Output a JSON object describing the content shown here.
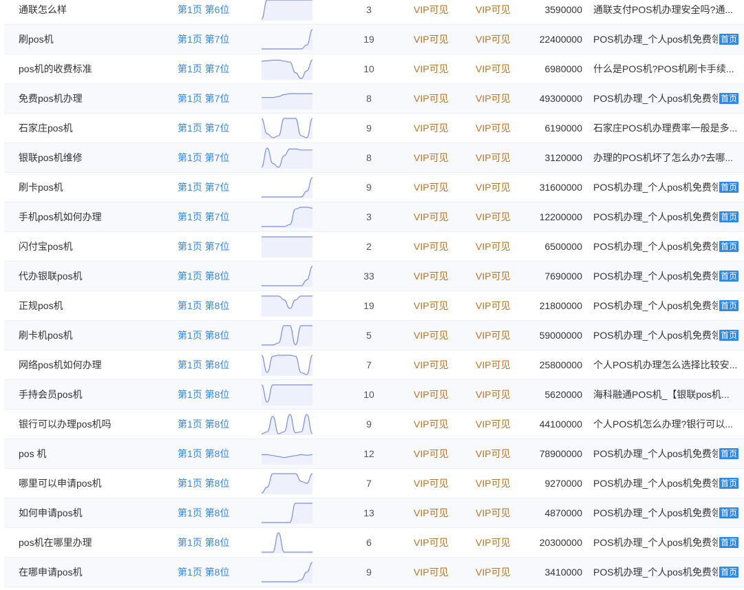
{
  "rows": [
    {
      "keyword": "通联怎么样",
      "rank": "第1页 第6位",
      "count": "3",
      "vip_a": "VIP可见",
      "vip_b": "VIP可见",
      "volume": "3590000",
      "title": "通联支付POS机办理安全吗?通...",
      "badge": "",
      "trend": [
        0.0,
        1.0,
        1.0,
        1.0,
        1.0,
        1.0,
        1.0,
        1.0,
        1.0,
        1.0
      ]
    },
    {
      "keyword": "刷pos机",
      "rank": "第1页 第7位",
      "count": "19",
      "vip_a": "VIP可见",
      "vip_b": "VIP可见",
      "volume": "22400000",
      "title": "POS机办理_个人pos机免费领",
      "badge": "首页",
      "trend": [
        0.0,
        0.0,
        0.0,
        0.0,
        0.0,
        0.0,
        0.0,
        0.0,
        0.2,
        1.0
      ]
    },
    {
      "keyword": "pos机的收费标准",
      "rank": "第1页 第7位",
      "count": "10",
      "vip_a": "VIP可见",
      "vip_b": "VIP可见",
      "volume": "6980000",
      "title": "什么是POS机?POS机刷卡手续...",
      "badge": "",
      "trend": [
        0.9,
        0.92,
        0.95,
        0.95,
        0.9,
        0.85,
        0.3,
        0.0,
        0.4,
        0.95
      ]
    },
    {
      "keyword": "免费pos机办理",
      "rank": "第1页 第7位",
      "count": "8",
      "vip_a": "VIP可见",
      "vip_b": "VIP可见",
      "volume": "49300000",
      "title": "POS机办理_个人pos机免费领",
      "badge": "首页",
      "trend": [
        0.55,
        0.55,
        0.55,
        0.6,
        0.7,
        0.75,
        0.75,
        0.75,
        0.75,
        0.75
      ]
    },
    {
      "keyword": "石家庄pos机",
      "rank": "第1页 第7位",
      "count": "9",
      "vip_a": "VIP可见",
      "vip_b": "VIP可见",
      "volume": "6190000",
      "title": "石家庄POS机办理费率一般是多...",
      "badge": "",
      "trend": [
        1.0,
        0.2,
        0.0,
        0.1,
        1.0,
        1.0,
        1.0,
        0.1,
        0.0,
        1.0
      ]
    },
    {
      "keyword": "银联pos机维修",
      "rank": "第1页 第7位",
      "count": "8",
      "vip_a": "VIP可见",
      "vip_b": "VIP可见",
      "volume": "3120000",
      "title": "办理的POS机坏了怎么办?去哪...",
      "badge": "",
      "trend": [
        0.0,
        1.0,
        0.2,
        0.0,
        0.6,
        0.95,
        0.95,
        0.9,
        0.9,
        0.9
      ]
    },
    {
      "keyword": "刷卡pos机",
      "rank": "第1页 第7位",
      "count": "9",
      "vip_a": "VIP可见",
      "vip_b": "VIP可见",
      "volume": "31600000",
      "title": "POS机办理_个人pos机免费领",
      "badge": "首页",
      "trend": [
        0.0,
        0.0,
        0.0,
        0.0,
        0.0,
        0.0,
        0.0,
        0.0,
        0.3,
        1.0
      ]
    },
    {
      "keyword": "手机pos机如何办理",
      "rank": "第1页 第7位",
      "count": "3",
      "vip_a": "VIP可见",
      "vip_b": "VIP可见",
      "volume": "12200000",
      "title": "POS机办理_个人pos机免费领",
      "badge": "首页",
      "trend": [
        0.0,
        0.0,
        0.0,
        0.0,
        0.0,
        0.1,
        0.9,
        1.0,
        1.0,
        0.95
      ]
    },
    {
      "keyword": "闪付宝pos机",
      "rank": "第1页 第7位",
      "count": "2",
      "vip_a": "VIP可见",
      "vip_b": "VIP可见",
      "volume": "6500000",
      "title": "POS机办理_个人pos机免费领",
      "badge": "首页",
      "trend": [
        1.0,
        1.0,
        1.0,
        1.0,
        1.0,
        1.0,
        1.0,
        1.0,
        1.0,
        1.0
      ]
    },
    {
      "keyword": "代办银联pos机",
      "rank": "第1页 第8位",
      "count": "33",
      "vip_a": "VIP可见",
      "vip_b": "VIP可见",
      "volume": "7690000",
      "title": "POS机办理_个人pos机免费领",
      "badge": "首页",
      "trend": [
        0.0,
        0.0,
        0.0,
        0.0,
        0.0,
        0.0,
        0.0,
        0.0,
        0.3,
        1.0
      ]
    },
    {
      "keyword": "正规pos机",
      "rank": "第1页 第8位",
      "count": "19",
      "vip_a": "VIP可见",
      "vip_b": "VIP可见",
      "volume": "21800000",
      "title": "POS机办理_个人pos机免费领",
      "badge": "首页",
      "trend": [
        1.0,
        1.0,
        1.0,
        1.0,
        0.8,
        0.35,
        0.8,
        1.0,
        1.0,
        1.0
      ]
    },
    {
      "keyword": "刷卡机pos机",
      "rank": "第1页 第8位",
      "count": "5",
      "vip_a": "VIP可见",
      "vip_b": "VIP可见",
      "volume": "59000000",
      "title": "POS机办理_个人pos机免费领",
      "badge": "首页",
      "trend": [
        0.0,
        0.0,
        0.0,
        0.1,
        1.0,
        1.0,
        0.0,
        1.0,
        1.0,
        1.0
      ]
    },
    {
      "keyword": "网络pos机如何办理",
      "rank": "第1页 第8位",
      "count": "7",
      "vip_a": "VIP可见",
      "vip_b": "VIP可见",
      "volume": "25800000",
      "title": "个人POS机办理怎么选择比较安...",
      "badge": "",
      "trend": [
        1.0,
        0.1,
        0.95,
        1.0,
        1.0,
        1.0,
        0.95,
        0.1,
        0.0,
        1.0
      ]
    },
    {
      "keyword": "手持会员pos机",
      "rank": "第1页 第8位",
      "count": "10",
      "vip_a": "VIP可见",
      "vip_b": "VIP可见",
      "volume": "5620000",
      "title": "海科融通POS机_【银联pos机...",
      "badge": "",
      "trend": [
        1.0,
        0.1,
        1.0,
        1.0,
        1.0,
        1.0,
        1.0,
        1.0,
        1.0,
        1.0
      ]
    },
    {
      "keyword": "银行可以办理pos机吗",
      "rank": "第1页 第8位",
      "count": "9",
      "vip_a": "VIP可见",
      "vip_b": "VIP可见",
      "volume": "44100000",
      "title": "个人POS机怎么办理?银行可以...",
      "badge": "",
      "trend": [
        0.0,
        0.1,
        0.9,
        0.0,
        0.1,
        1.0,
        0.05,
        0.1,
        1.0,
        0.0
      ]
    },
    {
      "keyword": "pos 机",
      "rank": "第1页 第8位",
      "count": "12",
      "vip_a": "VIP可见",
      "vip_b": "VIP可见",
      "volume": "78900000",
      "title": "POS机办理_个人pos机免费领",
      "badge": "首页",
      "trend": [
        0.45,
        0.45,
        0.4,
        0.35,
        0.3,
        0.35,
        0.4,
        0.45,
        0.42,
        0.45
      ]
    },
    {
      "keyword": "哪里可以申请pos机",
      "rank": "第1页 第8位",
      "count": "7",
      "vip_a": "VIP可见",
      "vip_b": "VIP可见",
      "volume": "9270000",
      "title": "POS机办理_个人pos机免费领",
      "badge": "首页",
      "trend": [
        0.0,
        0.3,
        1.0,
        1.0,
        1.0,
        1.0,
        1.0,
        0.6,
        0.5,
        1.0
      ]
    },
    {
      "keyword": "如何申请pos机",
      "rank": "第1页 第8位",
      "count": "13",
      "vip_a": "VIP可见",
      "vip_b": "VIP可见",
      "volume": "4870000",
      "title": "POS机办理_个人pos机免费领",
      "badge": "首页",
      "trend": [
        0.0,
        0.0,
        0.0,
        0.0,
        0.0,
        0.0,
        1.0,
        1.0,
        1.0,
        1.0
      ]
    },
    {
      "keyword": "pos机在哪里办理",
      "rank": "第1页 第8位",
      "count": "6",
      "vip_a": "VIP可见",
      "vip_b": "VIP可见",
      "volume": "20300000",
      "title": "POS机办理_个人pos机免费领",
      "badge": "首页",
      "trend": [
        0.0,
        0.0,
        0.0,
        1.0,
        0.0,
        0.0,
        0.0,
        0.0,
        0.0,
        0.0
      ]
    },
    {
      "keyword": "在哪申请pos机",
      "rank": "第1页 第8位",
      "count": "9",
      "vip_a": "VIP可见",
      "vip_b": "VIP可见",
      "volume": "3410000",
      "title": "POS机办理_个人pos机免费领",
      "badge": "首页",
      "trend": [
        0.0,
        0.0,
        0.0,
        0.0,
        0.0,
        0.0,
        0.0,
        0.1,
        0.5,
        1.0
      ]
    }
  ],
  "colors": {
    "trend_line": "#7b8fe0",
    "trend_fill": "#eef1fb",
    "rank_link": "#3b86d6",
    "vip_text": "#b5752f",
    "badge_bg": "#2f8ae5"
  }
}
